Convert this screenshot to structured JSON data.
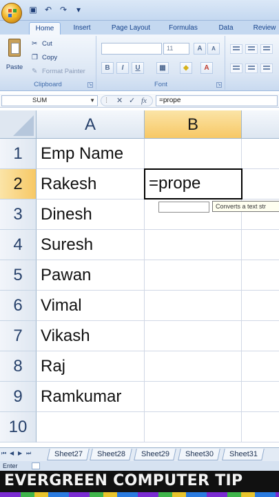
{
  "ribbon": {
    "tabs": [
      "Home",
      "Insert",
      "Page Layout",
      "Formulas",
      "Data",
      "Review"
    ],
    "active_tab": "Home",
    "clipboard": {
      "paste": "Paste",
      "cut": "Cut",
      "copy": "Copy",
      "format_painter": "Format Painter",
      "label": "Clipboard"
    },
    "font": {
      "size": "11",
      "label": "Font",
      "grow": "A",
      "shrink": "A",
      "bold": "B",
      "italic": "I",
      "underline": "U"
    }
  },
  "formula_bar": {
    "name_box": "SUM",
    "content": "=prope",
    "fx": "fx"
  },
  "columns": [
    "A",
    "B"
  ],
  "selected_column": "B",
  "rows": [
    {
      "num": "1",
      "a": "Emp Name"
    },
    {
      "num": "2",
      "a": "Rakesh"
    },
    {
      "num": "3",
      "a": "Dinesh"
    },
    {
      "num": "4",
      "a": "Suresh"
    },
    {
      "num": "5",
      "a": "Pawan"
    },
    {
      "num": "6",
      "a": "Vimal"
    },
    {
      "num": "7",
      "a": "Vikash"
    },
    {
      "num": "8",
      "a": "Raj"
    },
    {
      "num": "9",
      "a": "Ramkumar"
    },
    {
      "num": "10",
      "a": ""
    }
  ],
  "active_cell": {
    "ref": "B2",
    "value": "=prope"
  },
  "tooltip": "Converts a text str",
  "sheets": [
    "Sheet27",
    "Sheet28",
    "Sheet29",
    "Sheet30",
    "Sheet31"
  ],
  "status": {
    "mode": "Enter"
  },
  "banner": "EVERGREEN COMPUTER TIP",
  "icons": [
    "office-logo-icon",
    "save-icon",
    "undo-icon",
    "redo-icon",
    "cut-icon",
    "copy-icon",
    "format-painter-icon",
    "cancel-icon",
    "enter-icon",
    "fx-icon"
  ]
}
